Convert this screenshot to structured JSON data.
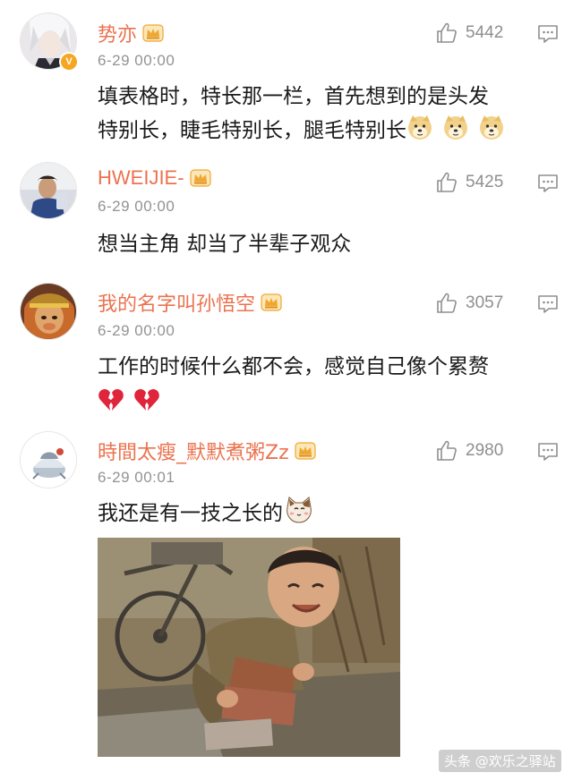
{
  "comments": [
    {
      "username": "势亦",
      "date": "6-29 00:00",
      "likes": "5442",
      "verified_badge": "V",
      "text_line1": "填表格时，特长那一栏，首先想到的是头发",
      "text_line2": "特别长，睫毛特别长，腿毛特别长",
      "emojis": [
        "doge-emoji",
        "doge-emoji",
        "doge-emoji"
      ]
    },
    {
      "username": "HWEIJIE-",
      "date": "6-29 00:00",
      "likes": "5425",
      "text_line1": "想当主角 却当了半辈子观众"
    },
    {
      "username": "我的名字叫孙悟空",
      "date": "6-29 00:00",
      "likes": "3057",
      "text_line1": "工作的时候什么都不会，感觉自己像个累赘",
      "emojis": [
        "broken-heart-emoji",
        "broken-heart-emoji"
      ]
    },
    {
      "username": "時間太瘦_默默煮粥Zz",
      "date": "6-29 00:01",
      "likes": "2980",
      "text_line1": "我还是有一技之长的",
      "emojis": [
        "cat-emoji"
      ]
    }
  ],
  "watermark": "头条 @欢乐之驿站",
  "colors": {
    "username": "#eb7350",
    "date": "#939393",
    "text": "#1a1a1a",
    "icon": "#8f8f8f",
    "crown": "#f5a623"
  },
  "icons": [
    "thumbs-up-icon",
    "comment-icon",
    "crown-icon",
    "verified-icon"
  ]
}
